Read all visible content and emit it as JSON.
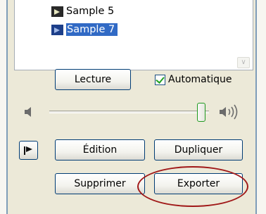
{
  "files": {
    "items": [
      {
        "label": "Sample 5",
        "selected": false,
        "icon": "media-file-icon"
      },
      {
        "label": "Sample 7",
        "selected": true,
        "icon": "media-file-icon"
      }
    ]
  },
  "controls": {
    "play_label": "Lecture",
    "auto_label": "Automatique",
    "auto_checked": true,
    "volume_level": 0.95
  },
  "actions": {
    "edit_label": "Édition",
    "duplicate_label": "Dupliquer",
    "delete_label": "Supprimer",
    "export_label": "Exporter"
  },
  "colors": {
    "selection": "#316ac5",
    "button_border": "#003c74",
    "annotation": "#a01818",
    "check": "#21a121"
  }
}
